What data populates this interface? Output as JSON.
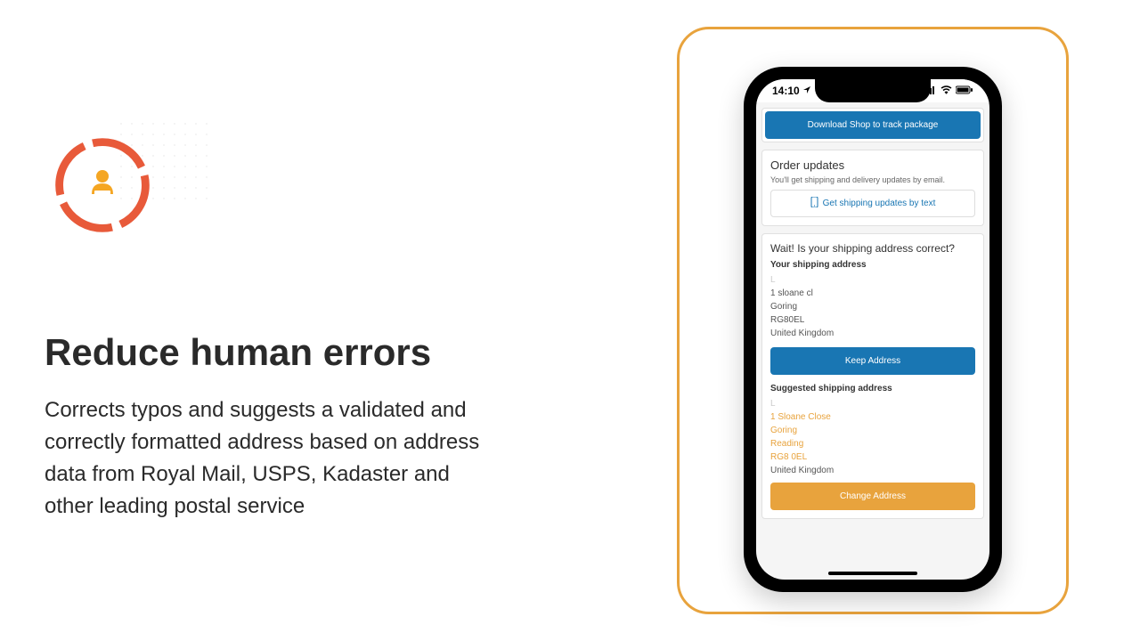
{
  "left": {
    "heading": "Reduce human errors",
    "body": "Corrects typos and suggests a validated and correctly formatted address based on address data from Royal Mail, USPS, Kadaster and other leading postal service"
  },
  "phone": {
    "time": "14:10",
    "download_btn": "Download Shop to track package",
    "order_updates_title": "Order updates",
    "order_updates_sub": "You'll get shipping and delivery updates by email.",
    "text_updates_btn": "Get shipping updates by text",
    "wait_title": "Wait! Is your shipping address correct?",
    "your_addr_label": "Your shipping address",
    "your_addr": {
      "name": "L",
      "line1": "1 sloane cl",
      "line2": "Goring",
      "postcode": "RG80EL",
      "country": "United Kingdom"
    },
    "keep_btn": "Keep Address",
    "suggested_label": "Suggested shipping address",
    "suggested": {
      "name": "L",
      "line1": "1 Sloane Close",
      "line2": "Goring",
      "line3": "Reading",
      "postcode": "RG8 0EL",
      "country": "United Kingdom"
    },
    "change_btn": "Change Address"
  }
}
